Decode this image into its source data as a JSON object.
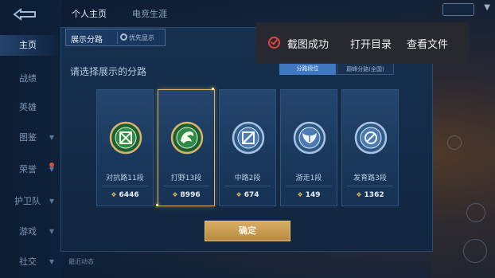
{
  "nav": {
    "items": [
      {
        "label": "主页",
        "active": true
      },
      {
        "label": "战绩",
        "active": false
      },
      {
        "label": "英雄",
        "active": false
      },
      {
        "label": "图鉴",
        "active": false
      },
      {
        "label": "荣誉",
        "active": false
      },
      {
        "label": "护卫队",
        "active": false
      },
      {
        "label": "游戏",
        "active": false
      },
      {
        "label": "社交",
        "active": false
      }
    ]
  },
  "top_tabs": [
    "个人主页",
    "电竞生涯"
  ],
  "panel": {
    "tab_title": "展示分路",
    "pref_label": "优先显示",
    "subtitle": "请选择展示的分路",
    "sort_tabs": [
      "分路段位",
      "巅峰分路(全国)"
    ],
    "confirm_label": "确定"
  },
  "lanes": [
    {
      "name": "对抗路11段",
      "score": "6446",
      "selected": false,
      "color": "#3fae5c",
      "icon": "shield-cross-icon"
    },
    {
      "name": "打野13段",
      "score": "8996",
      "selected": true,
      "color": "#3fae5c",
      "icon": "dragon-icon"
    },
    {
      "name": "中路2段",
      "score": "674",
      "selected": false,
      "color": "#7fa6d2",
      "icon": "slash-icon"
    },
    {
      "name": "游走1段",
      "score": "149",
      "selected": false,
      "color": "#7fa6d2",
      "icon": "wing-icon"
    },
    {
      "name": "发育路3段",
      "score": "1362",
      "selected": false,
      "color": "#7fa6d2",
      "icon": "target-icon"
    }
  ],
  "toast": {
    "message": "截图成功",
    "open_dir": "打开目录",
    "view_file": "查看文件"
  },
  "bottom_bar": {
    "label": "最近动态"
  }
}
